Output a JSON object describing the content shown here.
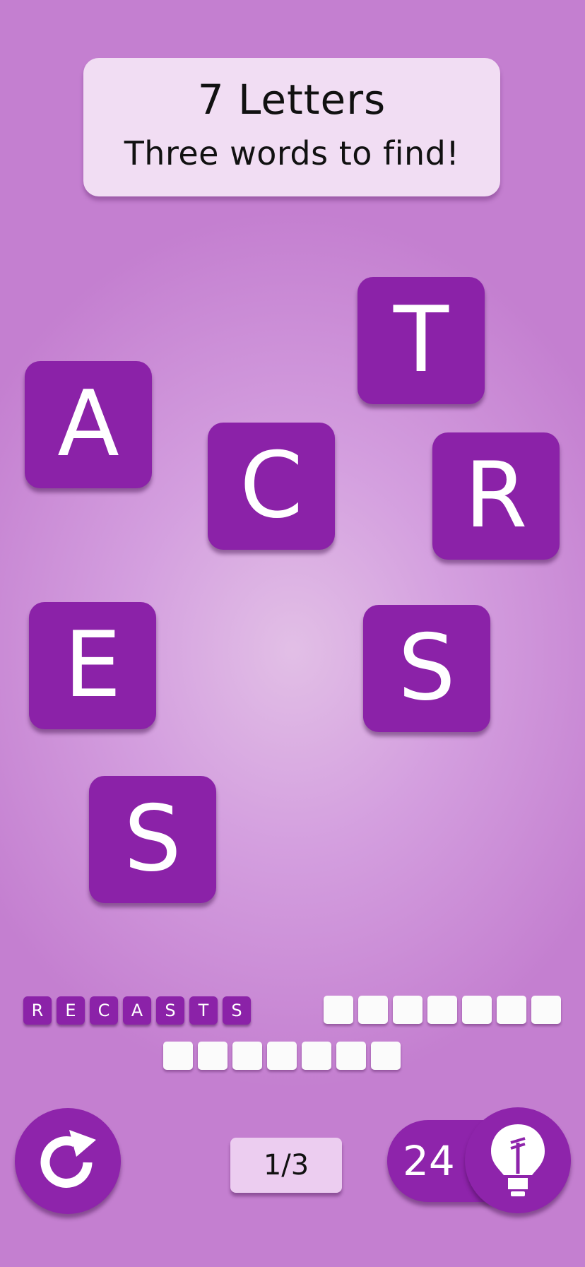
{
  "header": {
    "title": "7 Letters",
    "subtitle": "Three words to find!"
  },
  "tiles": [
    "T",
    "A",
    "C",
    "R",
    "E",
    "S",
    "S"
  ],
  "found_word": {
    "letters": [
      "R",
      "E",
      "C",
      "A",
      "S",
      "T",
      "S"
    ]
  },
  "progress": "1/3",
  "hints": {
    "count": "24",
    "icon": "lightbulb-icon"
  },
  "icons": {
    "refresh": "refresh-icon",
    "hint": "lightbulb-icon"
  },
  "colors": {
    "tile": "#8b22a8",
    "background": "#c47fd0",
    "header_card": "#f1ddf3",
    "blank_slot": "#fbfbfb"
  }
}
